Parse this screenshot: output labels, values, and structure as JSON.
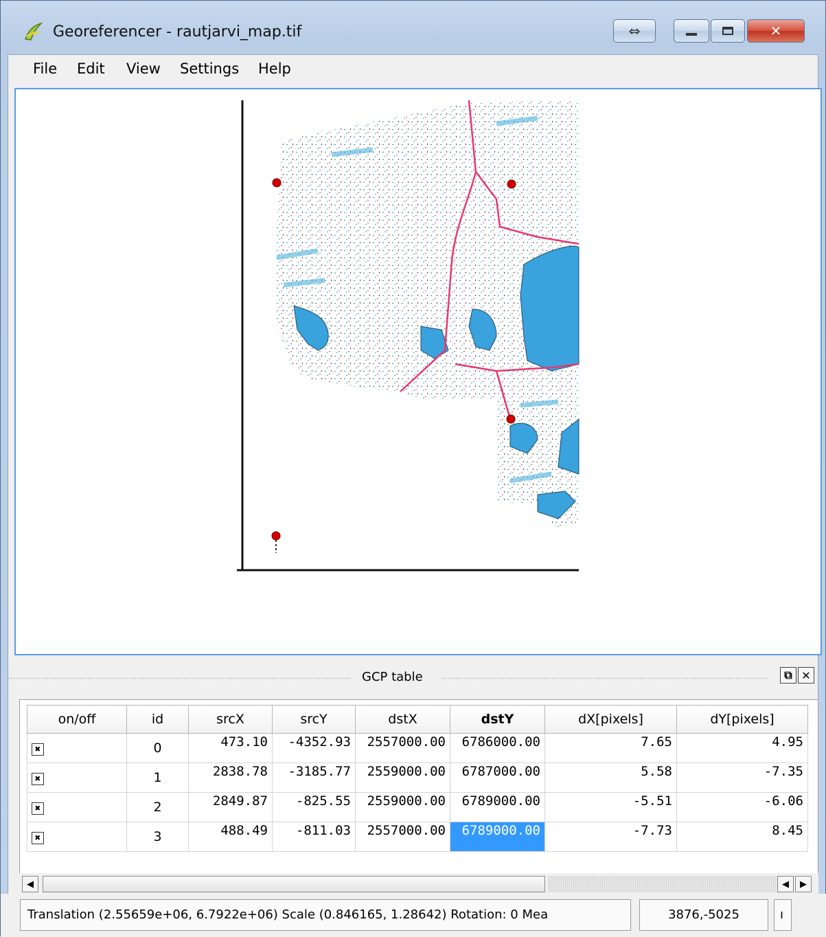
{
  "window": {
    "title": "Georeferencer - rautjarvi_map.tif",
    "controls": {
      "resize": "⇔",
      "minimize": "▭",
      "maximize": "▣",
      "close": "✕"
    }
  },
  "menu": [
    "File",
    "Edit",
    "View",
    "Settings",
    "Help"
  ],
  "toolbar": {
    "tools": [
      "open-raster-icon",
      "start-georeferencing-icon",
      "generate-gdal-script-icon",
      "load-gcp-points-icon",
      "save-gcp-points-icon",
      "transformation-settings-icon",
      "add-point-icon",
      "delete-point-icon",
      "move-gcp-point-icon",
      "pan-icon",
      "zoom-in-icon",
      "zoom-out-icon",
      "link-georeferencer-to-qgis-icon"
    ],
    "more_glyph": "»"
  },
  "gcp_panel": {
    "title": "GCP table",
    "columns": [
      "on/off",
      "id",
      "srcX",
      "srcY",
      "dstX",
      "dstY",
      "dX[pixels]",
      "dY[pixels]"
    ],
    "bold_column": "dstY",
    "rows": [
      {
        "enabled": "✖",
        "id": "0",
        "srcX": "473.10",
        "srcY": "-4352.93",
        "dstX": "2557000.00",
        "dstY": "6786000.00",
        "dX": "7.65",
        "dY": "4.95"
      },
      {
        "enabled": "✖",
        "id": "1",
        "srcX": "2838.78",
        "srcY": "-3185.77",
        "dstX": "2559000.00",
        "dstY": "6787000.00",
        "dX": "5.58",
        "dY": "-7.35"
      },
      {
        "enabled": "✖",
        "id": "2",
        "srcX": "2849.87",
        "srcY": "-825.55",
        "dstX": "2559000.00",
        "dstY": "6789000.00",
        "dX": "-5.51",
        "dY": "-6.06"
      },
      {
        "enabled": "✖",
        "id": "3",
        "srcX": "488.49",
        "srcY": "-811.03",
        "dstX": "2557000.00",
        "dstY": "6789000.00",
        "dX": "-7.73",
        "dY": "8.45"
      }
    ],
    "selected_cell": "3.dstY"
  },
  "status": {
    "transform_text": "Translation (2.55659e+06, 6.7922e+06) Scale (0.846165, 1.28642) Rotation: 0 Mea",
    "coordinates": "3876,-5025",
    "extra": "ı"
  },
  "colors": {
    "accent": "#3399ff",
    "canvas_border": "#5b9be3",
    "water": "#3aa2dd",
    "road": "#e8386e",
    "gcp_marker": "#d40000"
  }
}
